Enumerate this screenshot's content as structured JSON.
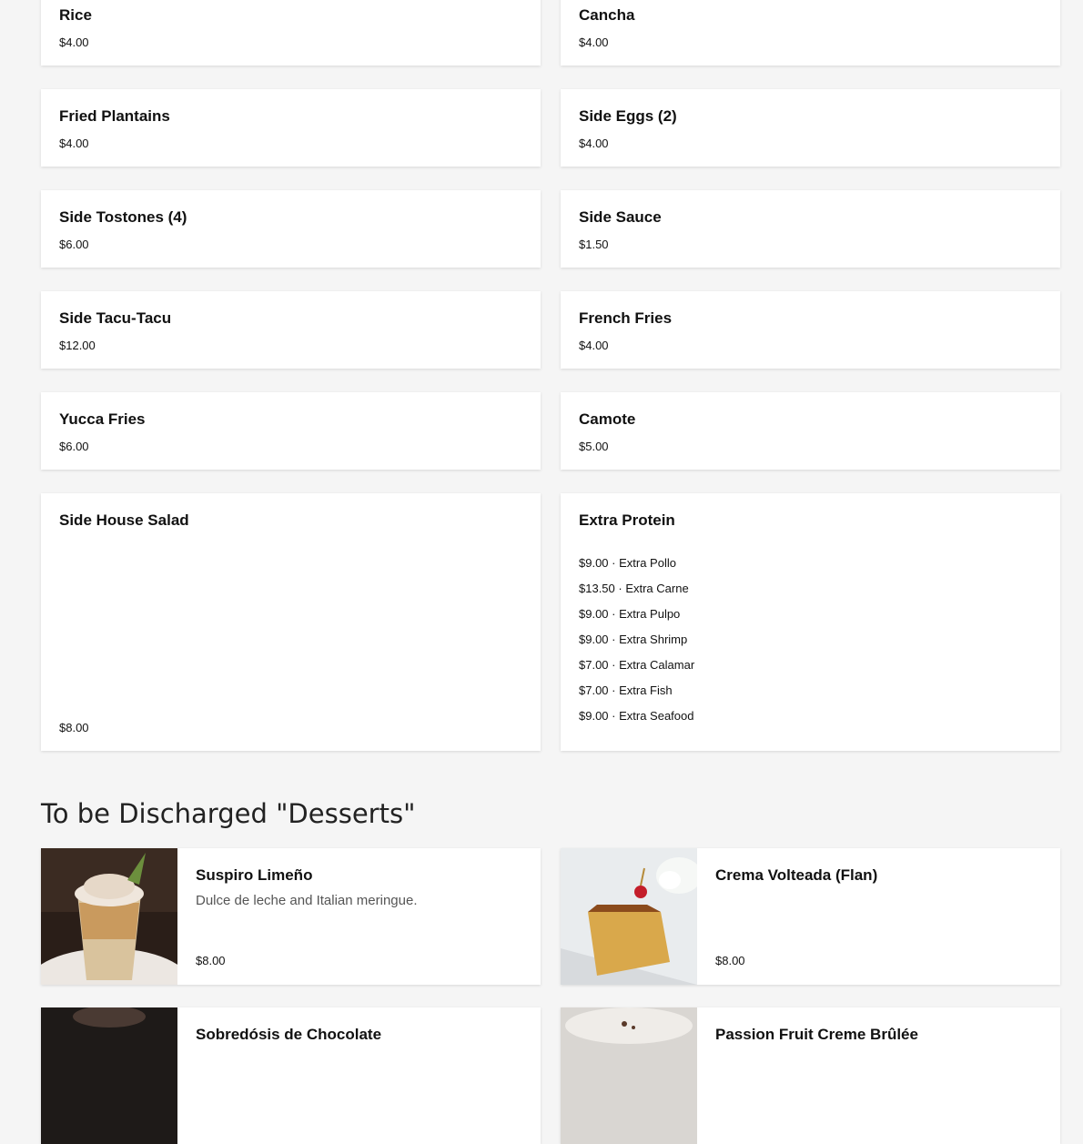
{
  "sides": [
    {
      "name": "Rice",
      "price": "$4.00"
    },
    {
      "name": "Cancha",
      "price": "$4.00"
    },
    {
      "name": "Fried Plantains",
      "price": "$4.00"
    },
    {
      "name": "Side Eggs (2)",
      "price": "$4.00"
    },
    {
      "name": "Side Tostones (4)",
      "price": "$6.00"
    },
    {
      "name": "Side Sauce",
      "price": "$1.50"
    },
    {
      "name": "Side Tacu-Tacu",
      "price": "$12.00"
    },
    {
      "name": "French Fries",
      "price": "$4.00"
    },
    {
      "name": "Yucca Fries",
      "price": "$6.00"
    },
    {
      "name": "Camote",
      "price": "$5.00"
    },
    {
      "name": "Side House Salad",
      "price": "$8.00"
    }
  ],
  "extra_protein": {
    "name": "Extra Protein",
    "options": [
      "$9.00 · Extra Pollo",
      "$13.50 · Extra Carne",
      "$9.00 · Extra Pulpo",
      "$9.00 · Extra Shrimp",
      "$7.00 · Extra Calamar",
      "$7.00 · Extra Fish",
      "$9.00 · Extra Seafood"
    ]
  },
  "desserts_section": {
    "title": "To be Discharged \"Desserts\"",
    "items": [
      {
        "name": "Suspiro Limeño",
        "description": "Dulce de leche and Italian meringue.",
        "price": "$8.00"
      },
      {
        "name": "Crema Volteada (Flan)",
        "description": "",
        "price": "$8.00"
      },
      {
        "name": "Sobredósis de Chocolate",
        "description": "",
        "price": ""
      },
      {
        "name": "Passion Fruit Creme Brûlée",
        "description": "",
        "price": ""
      }
    ]
  }
}
